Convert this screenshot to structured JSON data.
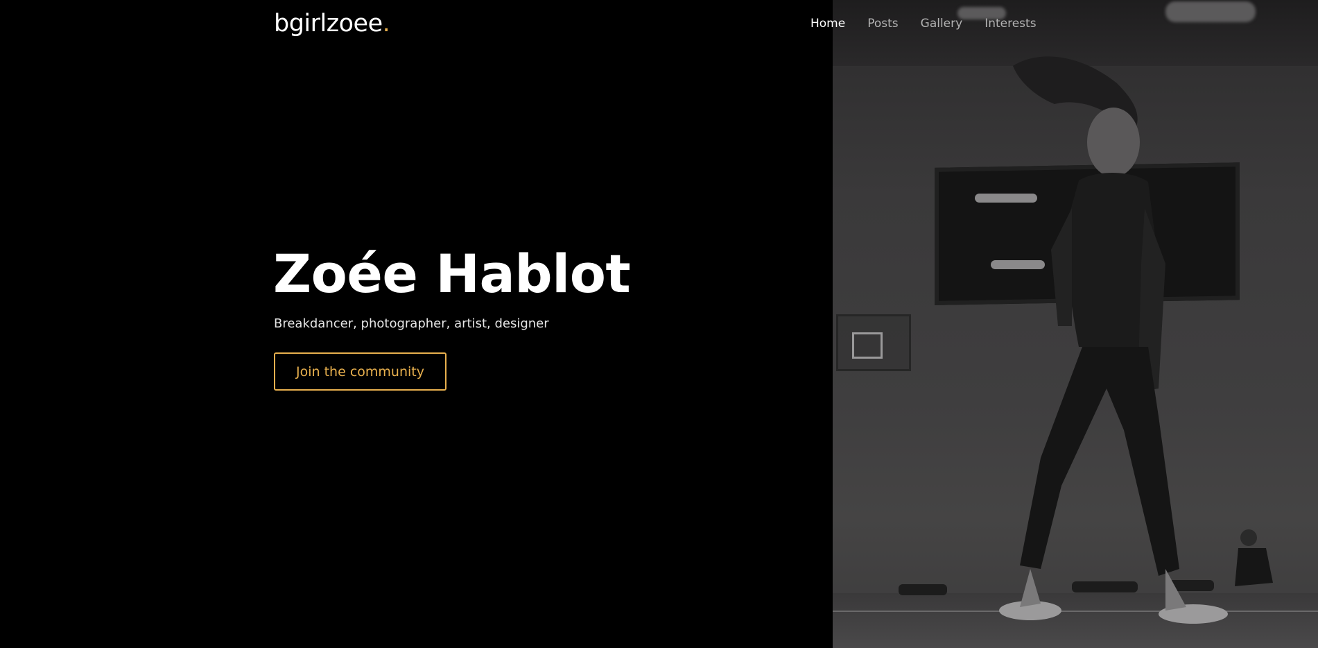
{
  "header": {
    "brand_name": "bgirlzoee",
    "brand_dot": ".",
    "nav": [
      {
        "label": "Home",
        "active": true
      },
      {
        "label": "Posts",
        "active": false
      },
      {
        "label": "Gallery",
        "active": false
      },
      {
        "label": "Interests",
        "active": false
      }
    ]
  },
  "hero": {
    "title": "Zoée Hablot",
    "subtitle": "Breakdancer, photographer, artist, designer",
    "cta_label": "Join the community"
  },
  "colors": {
    "accent": "#e8b04e",
    "background": "#000000",
    "text": "#ffffff",
    "nav_inactive": "#b3b3b3"
  }
}
